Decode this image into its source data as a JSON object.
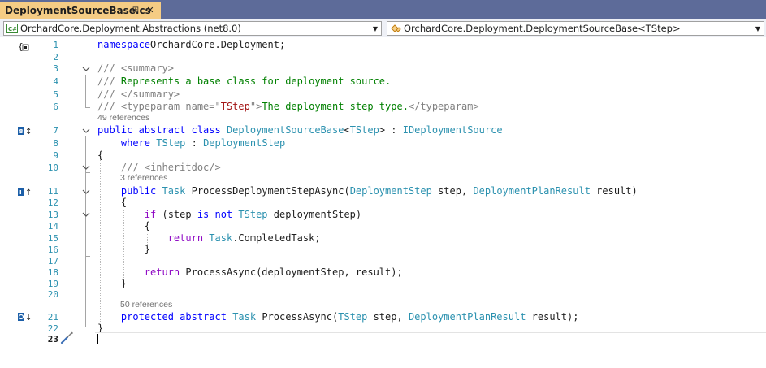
{
  "tab": {
    "title": "DeploymentSourceBase.cs",
    "pin_icon": "pin-icon",
    "close_icon": "close-icon"
  },
  "navbar": {
    "project": "OrchardCore.Deployment.Abstractions (net8.0)",
    "type": "OrchardCore.Deployment.DeploymentSourceBase<TStep>"
  },
  "lenses": {
    "l1": "49 references",
    "l2": "3 references",
    "l3": "50 references"
  },
  "line_numbers": [
    "1",
    "2",
    "3",
    "4",
    "5",
    "6",
    "7",
    "8",
    "9",
    "10",
    "11",
    "12",
    "13",
    "14",
    "15",
    "16",
    "17",
    "18",
    "19",
    "20",
    "21",
    "22",
    "23"
  ],
  "code": {
    "l1": [
      [
        "kw",
        "namespace"
      ],
      [
        "",
        "OrchardCore.Deployment;"
      ]
    ],
    "l3": [
      [
        "xml",
        "/// "
      ],
      [
        "xml",
        "<summary>"
      ]
    ],
    "l4": [
      [
        "xml",
        "/// "
      ],
      [
        "cmt",
        "Represents a base class for deployment source."
      ]
    ],
    "l5": [
      [
        "xml",
        "/// "
      ],
      [
        "xml",
        "</summary>"
      ]
    ],
    "l6": [
      [
        "xml",
        "/// "
      ],
      [
        "xml",
        "<typeparam name=\""
      ],
      [
        "str",
        "TStep"
      ],
      [
        "xml",
        "\">"
      ],
      [
        "cmt",
        "The deployment step type."
      ],
      [
        "xml",
        "</typeparam>"
      ]
    ],
    "l7": [
      [
        "kw",
        "public abstract class "
      ],
      [
        "typ",
        "DeploymentSourceBase"
      ],
      [
        "",
        "<"
      ],
      [
        "typ",
        "TStep"
      ],
      [
        "",
        "> : "
      ],
      [
        "typ",
        "IDeploymentSource"
      ]
    ],
    "l8": [
      [
        "",
        "    "
      ],
      [
        "kw",
        "where "
      ],
      [
        "typ",
        "TStep"
      ],
      [
        "",
        " : "
      ],
      [
        "typ",
        "DeploymentStep"
      ]
    ],
    "l9": [
      [
        "",
        "{"
      ]
    ],
    "l10": [
      [
        "",
        "    "
      ],
      [
        "xml",
        "/// <inheritdoc/>"
      ]
    ],
    "l11": [
      [
        "",
        "    "
      ],
      [
        "kw",
        "public "
      ],
      [
        "typ",
        "Task "
      ],
      [
        "",
        "ProcessDeploymentStepAsync("
      ],
      [
        "typ",
        "DeploymentStep"
      ],
      [
        "",
        " step, "
      ],
      [
        "typ",
        "DeploymentPlanResult"
      ],
      [
        "",
        " result)"
      ]
    ],
    "l12": [
      [
        "",
        "    {"
      ]
    ],
    "l13": [
      [
        "",
        "        "
      ],
      [
        "ctl",
        "if"
      ],
      [
        "",
        " (step "
      ],
      [
        "kw",
        "is not "
      ],
      [
        "typ",
        "TStep"
      ],
      [
        "",
        " deploymentStep)"
      ]
    ],
    "l14": [
      [
        "",
        "        {"
      ]
    ],
    "l15": [
      [
        "",
        "            "
      ],
      [
        "ctl",
        "return "
      ],
      [
        "typ",
        "Task"
      ],
      [
        "",
        ".CompletedTask;"
      ]
    ],
    "l16": [
      [
        "",
        "        }"
      ]
    ],
    "l18": [
      [
        "",
        "        "
      ],
      [
        "ctl",
        "return "
      ],
      [
        "",
        "ProcessAsync(deploymentStep, result);"
      ]
    ],
    "l19": [
      [
        "",
        "    }"
      ]
    ],
    "l21": [
      [
        "",
        "    "
      ],
      [
        "kw",
        "protected abstract "
      ],
      [
        "typ",
        "Task "
      ],
      [
        "",
        "ProcessAsync("
      ],
      [
        "typ",
        "TStep"
      ],
      [
        "",
        " step, "
      ],
      [
        "typ",
        "DeploymentPlanResult"
      ],
      [
        "",
        " result);"
      ]
    ],
    "l22": [
      [
        "",
        "}"
      ]
    ]
  }
}
